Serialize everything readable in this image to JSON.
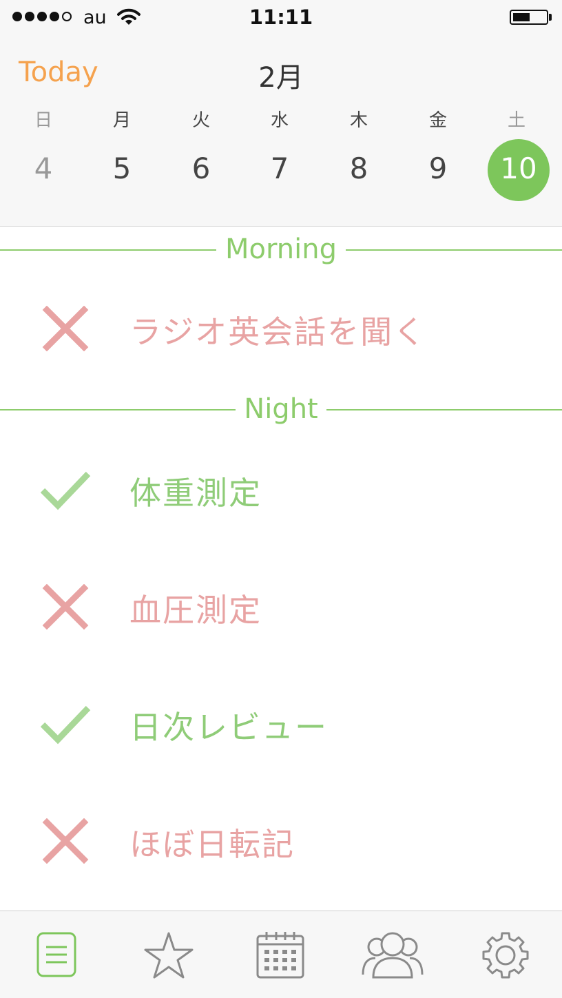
{
  "status_bar": {
    "carrier": "au",
    "time": "11:11"
  },
  "calendar": {
    "today_label": "Today",
    "month": "2月",
    "weekdays": [
      "日",
      "月",
      "火",
      "水",
      "木",
      "金",
      "土"
    ],
    "days": [
      "4",
      "5",
      "6",
      "7",
      "8",
      "9",
      "10"
    ],
    "selected_day": "10"
  },
  "sections": [
    {
      "title": "Morning",
      "tasks": [
        {
          "label": "ラジオ英会話を聞く",
          "status": "missed"
        }
      ]
    },
    {
      "title": "Night",
      "tasks": [
        {
          "label": "体重測定",
          "status": "done"
        },
        {
          "label": "血圧測定",
          "status": "missed"
        },
        {
          "label": "日次レビュー",
          "status": "done"
        },
        {
          "label": "ほぼ日転記",
          "status": "missed"
        }
      ]
    }
  ],
  "tab_bar": {
    "tabs": [
      {
        "icon": "list-icon",
        "active": true
      },
      {
        "icon": "star-icon",
        "active": false
      },
      {
        "icon": "calendar-icon",
        "active": false
      },
      {
        "icon": "people-icon",
        "active": false
      },
      {
        "icon": "gear-icon",
        "active": false
      }
    ]
  },
  "colors": {
    "accent_orange": "#f5a24e",
    "green": "#7dc65b",
    "done_green": "#8fcc78",
    "missed_red": "#e8a3a3"
  }
}
